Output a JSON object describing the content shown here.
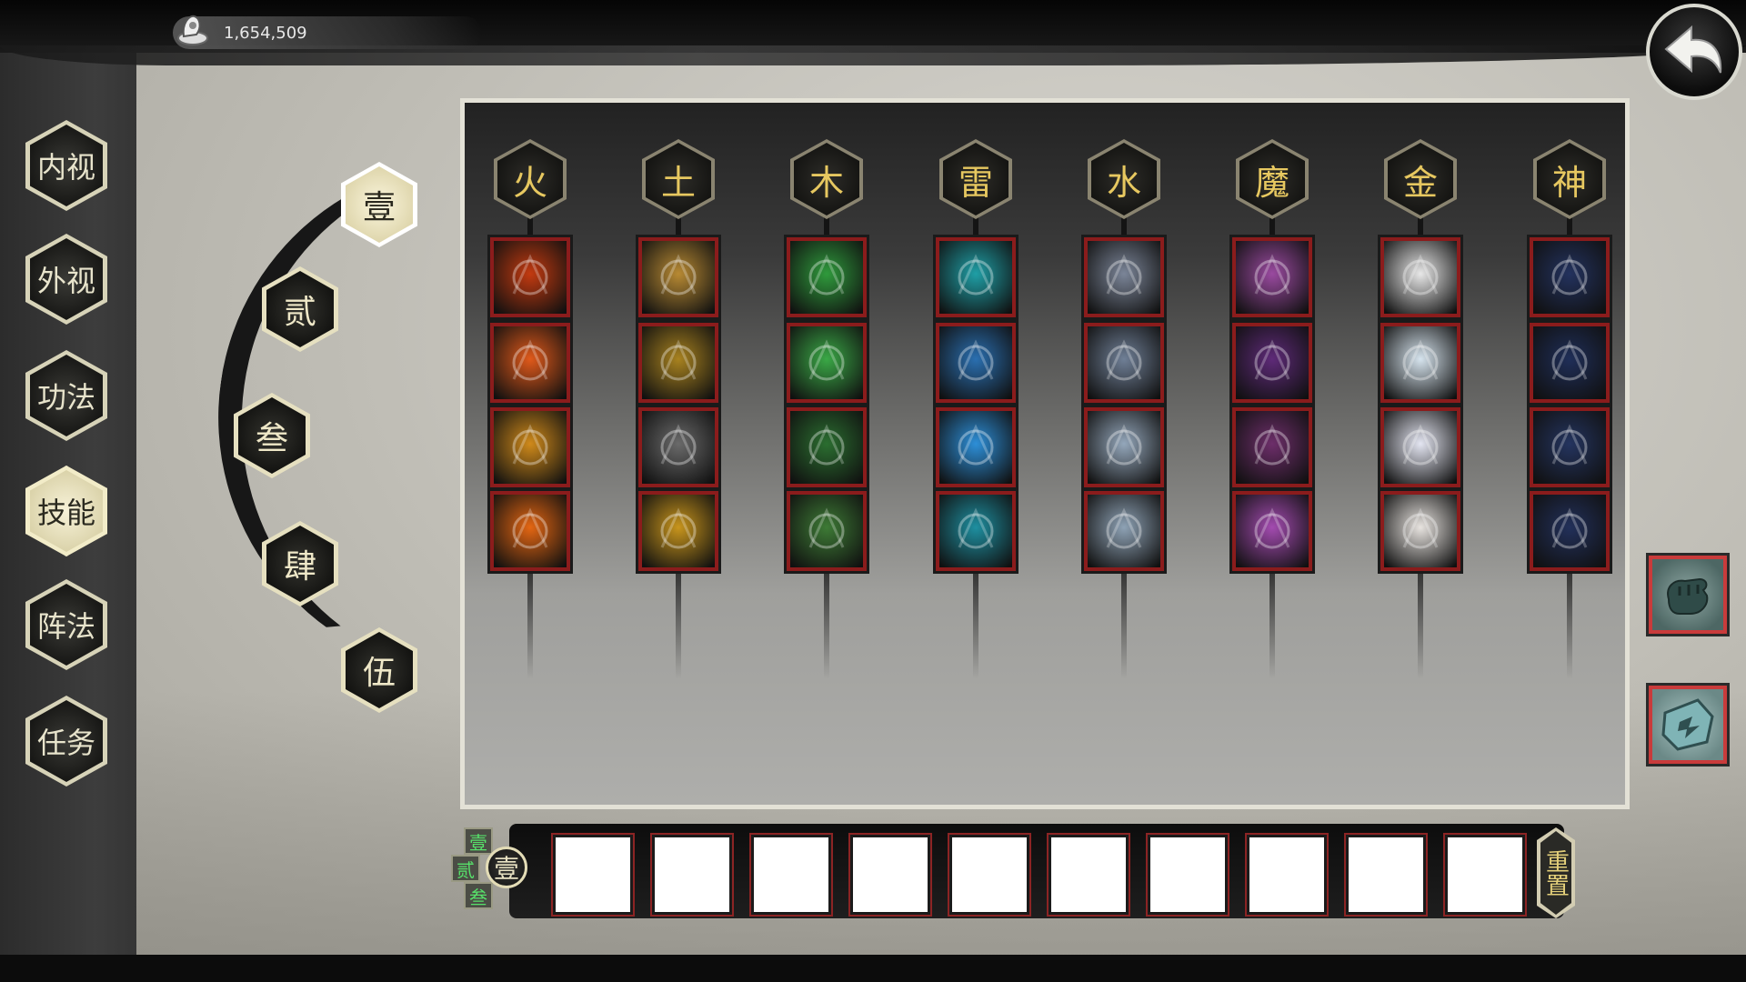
{
  "currency": {
    "value": "1,654,509",
    "icon": "ancient-coin-icon"
  },
  "back_button": {
    "icon": "back-arrow-icon"
  },
  "nav": [
    {
      "id": "inner",
      "label": "内视",
      "active": false
    },
    {
      "id": "outer",
      "label": "外视",
      "active": false
    },
    {
      "id": "method",
      "label": "功法",
      "active": false
    },
    {
      "id": "skills",
      "label": "技能",
      "active": true
    },
    {
      "id": "formation",
      "label": "阵法",
      "active": false
    },
    {
      "id": "tasks",
      "label": "任务",
      "active": false
    }
  ],
  "tiers": [
    {
      "label": "壹",
      "active": true
    },
    {
      "label": "贰",
      "active": false
    },
    {
      "label": "叁",
      "active": false
    },
    {
      "label": "肆",
      "active": false
    },
    {
      "label": "伍",
      "active": false
    }
  ],
  "elements": [
    {
      "label": "火",
      "skills": [
        "fire-ring-icon",
        "fire-slash-icon",
        "fire-eye-icon",
        "flame-icon"
      ],
      "colors": [
        "#c33a10",
        "#e0591a",
        "#d08a1a",
        "#e46612"
      ]
    },
    {
      "label": "土",
      "skills": [
        "earth-spike-icon",
        "earth-fortress-icon",
        "stone-golem-icon",
        "golden-body-icon"
      ],
      "colors": [
        "#b88a33",
        "#a8821f",
        "#6a6a6a",
        "#c8951c"
      ]
    },
    {
      "label": "木",
      "skills": [
        "leaf-swirl-icon",
        "wood-vortex-icon",
        "forest-guard-icon",
        "thorn-burst-icon"
      ],
      "colors": [
        "#2f9a3c",
        "#3aa846",
        "#2b6e30",
        "#3d7a35"
      ]
    },
    {
      "label": "雷",
      "skills": [
        "lightning-bolt-icon",
        "thunder-armor-icon",
        "plasma-burst-icon",
        "shock-runner-icon"
      ],
      "colors": [
        "#1f9fa6",
        "#2a6fb0",
        "#2d8fd8",
        "#1e8fa0"
      ]
    },
    {
      "label": "水",
      "skills": [
        "water-orb-icon",
        "water-shield-icon",
        "ice-crystal-icon",
        "ice-spike-icon"
      ],
      "colors": [
        "#7b8598",
        "#6f7f96",
        "#94a7bb",
        "#8ea2b5"
      ]
    },
    {
      "label": "魔",
      "skills": [
        "demon-eye-icon",
        "demon-lord-icon",
        "dark-spear-icon",
        "void-blade-icon"
      ],
      "colors": [
        "#9a4aa0",
        "#5e2a78",
        "#6d2e6a",
        "#a34bb0"
      ]
    },
    {
      "label": "金",
      "skills": [
        "metal-dagger-icon",
        "metal-orb-icon",
        "spirit-sword-icon",
        "twin-blades-icon"
      ],
      "colors": [
        "#e8e8e8",
        "#d6e4ee",
        "#e4e6f2",
        "#e8e4e0"
      ]
    },
    {
      "label": "神",
      "skills": [
        "divine-seal-a-icon",
        "divine-seal-b-icon",
        "divine-seal-c-icon",
        "divine-seal-d-icon"
      ],
      "colors": [
        "#23325e",
        "#1f2e58",
        "#24345f",
        "#22305a"
      ]
    }
  ],
  "side_buttons": [
    {
      "icon": "fist-icon"
    },
    {
      "icon": "shield-icon"
    }
  ],
  "loadout": {
    "presets": [
      "壹",
      "贰",
      "叁"
    ],
    "current": "壹",
    "slot_count": 10,
    "reset_label": "重置"
  }
}
